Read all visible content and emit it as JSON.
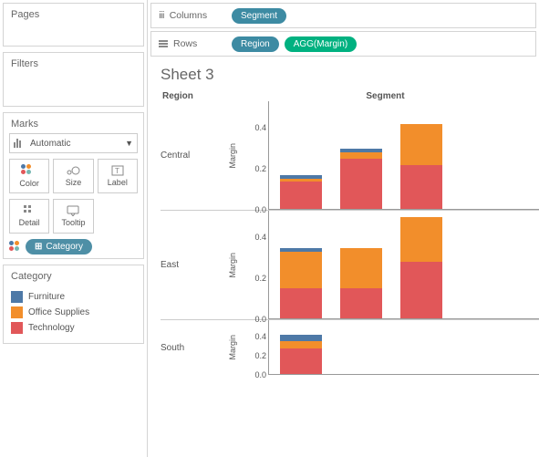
{
  "shelves": {
    "columns_label": "Columns",
    "rows_label": "Rows",
    "columns_pill": "Segment",
    "rows_pill1": "Region",
    "rows_pill2": "AGG(Margin)"
  },
  "panels": {
    "pages": "Pages",
    "filters": "Filters",
    "marks": "Marks",
    "mark_type": "Automatic",
    "color": "Color",
    "size": "Size",
    "label": "Label",
    "detail": "Detail",
    "tooltip": "Tooltip",
    "category_pill": "Category"
  },
  "legend": {
    "title": "Category",
    "items": [
      "Furniture",
      "Office Supplies",
      "Technology"
    ]
  },
  "sheet": {
    "title": "Sheet 3",
    "region_header": "Region",
    "segment_header": "Segment",
    "y_title": "Margin",
    "ticks": [
      "0.0",
      "0.2",
      "0.4"
    ]
  },
  "chart_data": {
    "type": "bar",
    "stacked": true,
    "ylabel": "Margin",
    "ylim": [
      0,
      0.5
    ],
    "row_facet": "Region",
    "col_facet": "Segment",
    "stack_series": [
      "Furniture",
      "Office Supplies",
      "Technology"
    ],
    "colors": {
      "Furniture": "#4e79a7",
      "Office Supplies": "#f28e2b",
      "Technology": "#e15759"
    },
    "rows": [
      {
        "region": "Central",
        "bars": [
          {
            "Furniture": 0.02,
            "Office Supplies": 0.01,
            "Technology": 0.14
          },
          {
            "Furniture": 0.02,
            "Office Supplies": 0.03,
            "Technology": 0.25
          },
          {
            "Furniture": 0.0,
            "Office Supplies": 0.2,
            "Technology": 0.22
          }
        ]
      },
      {
        "region": "East",
        "bars": [
          {
            "Furniture": 0.02,
            "Office Supplies": 0.18,
            "Technology": 0.15
          },
          {
            "Furniture": 0.0,
            "Office Supplies": 0.2,
            "Technology": 0.15
          },
          {
            "Furniture": 0.0,
            "Office Supplies": 0.23,
            "Technology": 0.3
          }
        ]
      },
      {
        "region": "South",
        "bars": [
          {
            "Furniture": 0.06,
            "Office Supplies": 0.08,
            "Technology": 0.28
          },
          {
            "Furniture": 0.0,
            "Office Supplies": 0.0,
            "Technology": 0.0
          },
          {
            "Furniture": 0.0,
            "Office Supplies": 0.0,
            "Technology": 0.0
          }
        ]
      }
    ]
  }
}
